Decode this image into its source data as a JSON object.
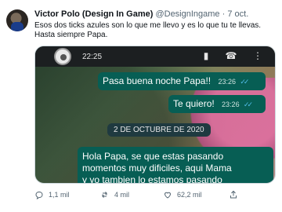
{
  "tweet": {
    "author_name": "Victor Polo (Design In Game)",
    "handle": "@DesignIngame",
    "separator": "·",
    "date": "7 oct.",
    "text_lines": [
      "Esos dos ticks azules son lo que me llevo y es lo que tu te llevas.",
      "Hasta siempre Papa."
    ]
  },
  "media": {
    "chat_header_time": "22:25",
    "messages": [
      {
        "text": "Pasa buena noche Papa!!",
        "time": "23:26",
        "ticks": "✓✓"
      },
      {
        "text": "Te quiero!",
        "time": "23:26",
        "ticks": "✓✓"
      }
    ],
    "date_chip": "2 DE OCTUBRE DE 2020",
    "long_message_lines": [
      "Hola Papa, se que estas pasando",
      "momentos muy dificiles, aqui Mama",
      "y yo tambien lo estamos pasando"
    ]
  },
  "actions": {
    "replies": "1,1 mil",
    "retweets": "4 mil",
    "likes": "62,2 mil"
  },
  "colors": {
    "bubble": "#075e54",
    "ticks": "#53bdeb",
    "meta": "#536471"
  }
}
